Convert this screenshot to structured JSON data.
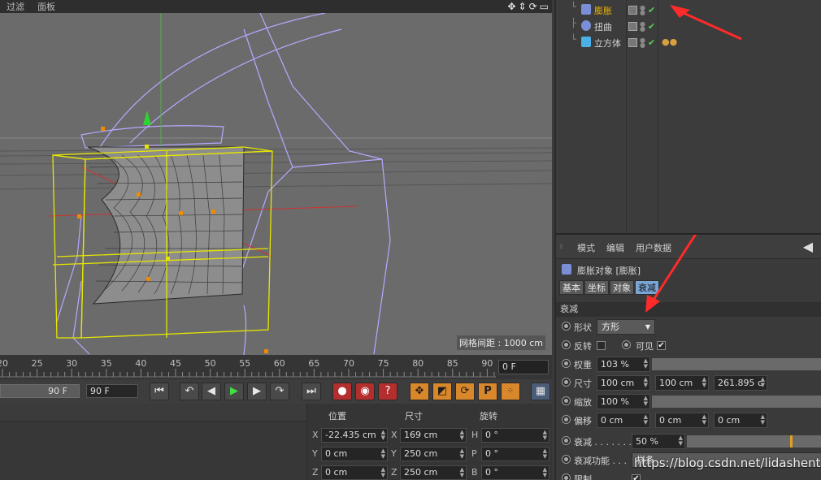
{
  "viewport": {
    "menus": [
      "过滤",
      "面板"
    ],
    "nav_icons": [
      "move-view-icon",
      "dolly-icon",
      "rotate-view-icon",
      "maximize-icon"
    ],
    "grid_spacing": "网格间距 : 1000 cm"
  },
  "timeline": {
    "ticks": [
      "20",
      "25",
      "30",
      "35",
      "40",
      "45",
      "50",
      "55",
      "60",
      "65",
      "70",
      "75",
      "80",
      "85",
      "90"
    ],
    "current_frame": "0 F"
  },
  "transport": {
    "end_slider": "90 F",
    "end_field": "90 F",
    "buttons": [
      "go-start-icon",
      "prev-key-icon",
      "prev-frame-icon",
      "play-icon",
      "next-frame-icon",
      "next-key-icon",
      "go-end-icon",
      "record-icon",
      "autokey-icon",
      "keyframe-help-icon",
      "move-tool-icon",
      "scale-tool-icon",
      "rotate-tool-icon",
      "parameter-icon",
      "points-icon",
      "timeline-icon"
    ]
  },
  "coords": {
    "headers": {
      "position": "位置",
      "size": "尺寸",
      "rotation": "旋转"
    },
    "rows": [
      {
        "axis_pos": "X",
        "pos": "-22.435 cm",
        "axis_size": "X",
        "size": "169 cm",
        "axis_rot": "H",
        "rot": "0 °"
      },
      {
        "axis_pos": "Y",
        "pos": "0 cm",
        "axis_size": "Y",
        "size": "250 cm",
        "axis_rot": "P",
        "rot": "0 °"
      },
      {
        "axis_pos": "Z",
        "pos": "0 cm",
        "axis_size": "Z",
        "size": "250 cm",
        "axis_rot": "B",
        "rot": "0 °"
      }
    ]
  },
  "objects": [
    {
      "name": "膨胀",
      "active": true,
      "tree": "└",
      "icon_color": "#7a8fd6"
    },
    {
      "name": "扭曲",
      "active": false,
      "tree": "├",
      "icon_color": "#7a8fd6"
    },
    {
      "name": "立方体",
      "active": false,
      "tree": "└",
      "icon_color": "#4ab0e6"
    }
  ],
  "attributes": {
    "menus": [
      "模式",
      "编辑",
      "用户数据"
    ],
    "title": "膨胀对象 [膨胀]",
    "tabs": [
      "基本",
      "坐标",
      "对象",
      "衰减"
    ],
    "active_tab": "衰减",
    "section": "衰减",
    "shape_label": "形状",
    "shape_value": "方形",
    "invert_label": "反转",
    "visible_label": "可见",
    "weight_label": "权重",
    "weight_value": "103 %",
    "size_label": "尺寸",
    "size_values": [
      "100 cm",
      "100 cm",
      "261.895 c"
    ],
    "scale_label": "缩放",
    "scale_value": "100 %",
    "offset_label": "偏移",
    "offset_values": [
      "0 cm",
      "0 cm",
      "0 cm"
    ],
    "falloff_label": "衰减 . . . . . . .",
    "falloff_value": "50 %",
    "falloff_func_label": "衰减功能 . . .",
    "falloff_func_value": "样条",
    "limit_label": "限制 . . . . . . ."
  },
  "watermark": "https://blog.csdn.net/lidashent",
  "colors": {
    "active_object": "#f0b400",
    "active_tab": "#7aa6d6",
    "record": "#b52e2e",
    "falloff_marker": "#e0a020"
  }
}
